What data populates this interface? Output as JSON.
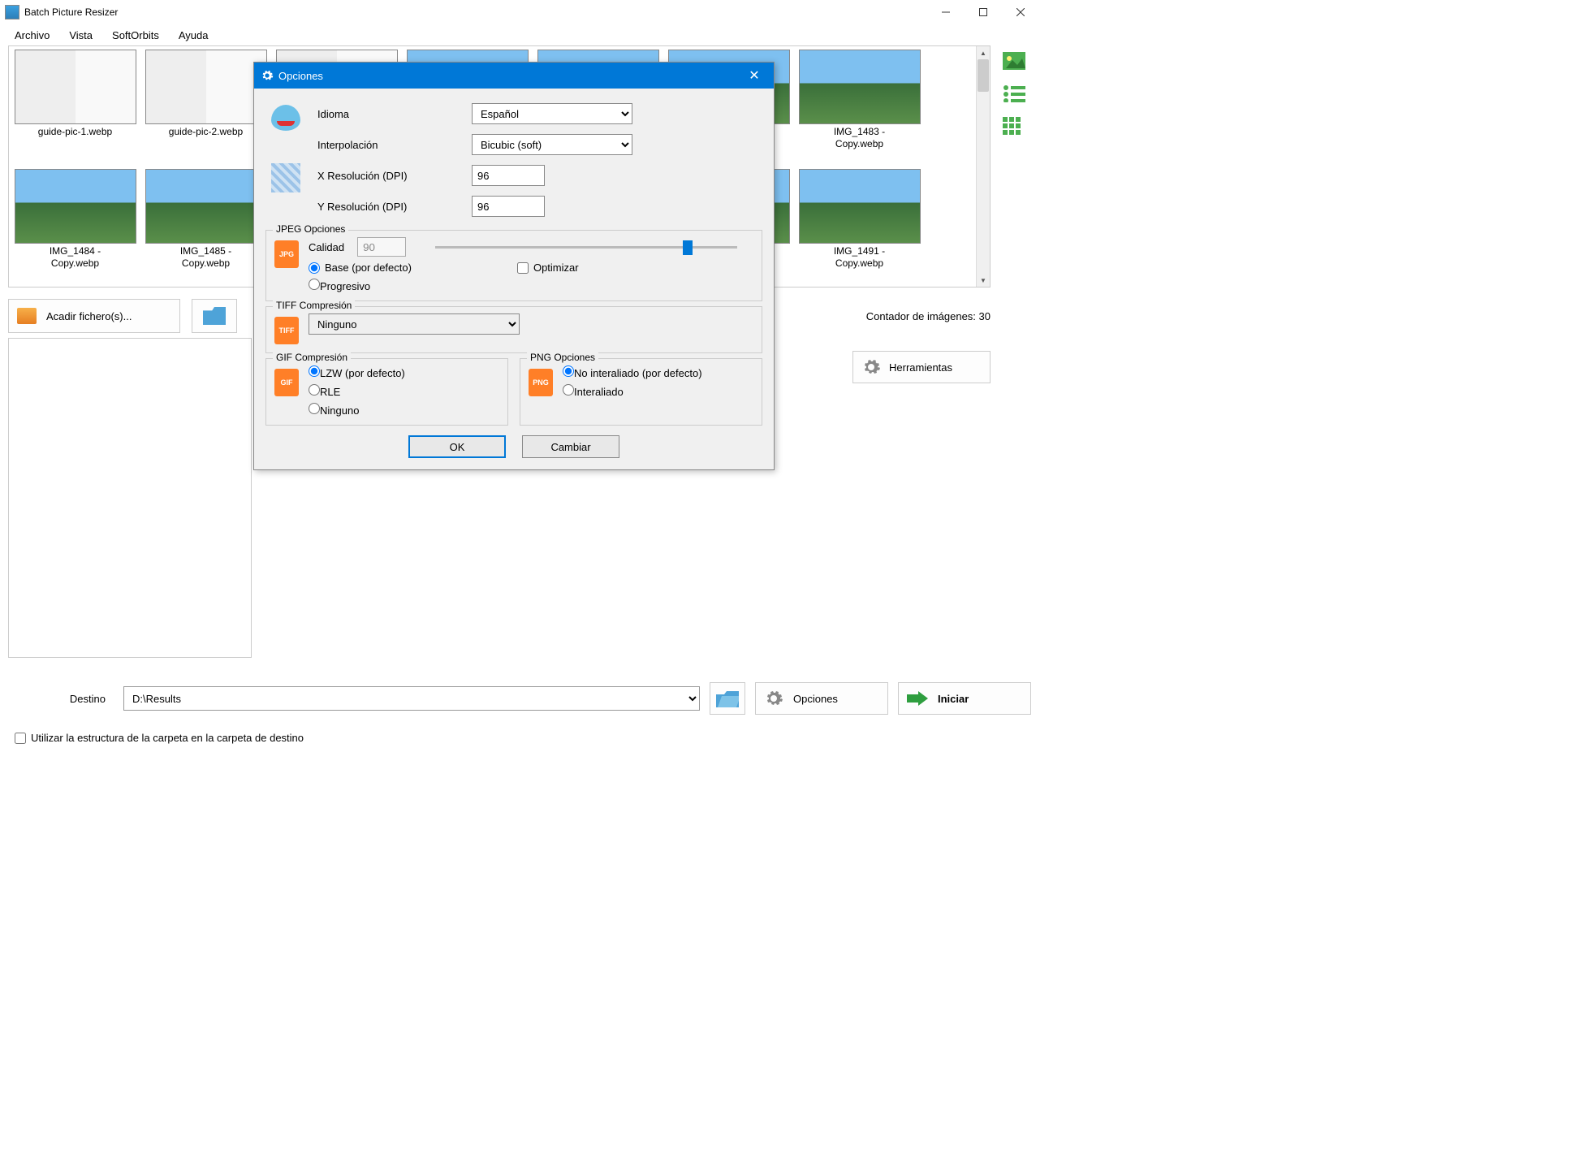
{
  "app": {
    "title": "Batch Picture Resizer"
  },
  "menu": {
    "archivo": "Archivo",
    "vista": "Vista",
    "softorbits": "SoftOrbits",
    "ayuda": "Ayuda"
  },
  "thumbs": [
    {
      "label": "guide-pic-1.webp",
      "kind": "doc"
    },
    {
      "label": "guide-pic-2.webp",
      "kind": "doc"
    },
    {
      "label": "",
      "kind": "doc"
    },
    {
      "label": "",
      "kind": "photo"
    },
    {
      "label": "",
      "kind": "photo"
    },
    {
      "label": "",
      "kind": "photo"
    },
    {
      "label": "IMG_1483 -\nCopy.webp",
      "kind": "photo"
    },
    {
      "label": "IMG_1484 -\nCopy.webp",
      "kind": "photo"
    },
    {
      "label": "IMG_1485 -\nCopy.webp",
      "kind": "photo"
    },
    {
      "label": "",
      "kind": "photo"
    },
    {
      "label": "",
      "kind": "photo"
    },
    {
      "label": "",
      "kind": "photo"
    },
    {
      "label": "",
      "kind": "photo"
    },
    {
      "label": "IMG_1491 -\nCopy.webp",
      "kind": "photo"
    }
  ],
  "toolbar": {
    "add_files": "Acadir fichero(s)...",
    "counter": "Contador de imágenes: 30",
    "herramientas": "Herramientas"
  },
  "bottom": {
    "destino_label": "Destino",
    "destino_value": "D:\\Results",
    "opciones": "Opciones",
    "iniciar": "Iniciar",
    "checkbox": "Utilizar la estructura de la carpeta en la carpeta de destino"
  },
  "dialog": {
    "title": "Opciones",
    "idioma_label": "Idioma",
    "idioma_value": "Español",
    "interp_label": "Interpolación",
    "interp_value": "Bicubic (soft)",
    "xres_label": "X Resolución (DPI)",
    "xres_value": "96",
    "yres_label": "Y Resolución (DPI)",
    "yres_value": "96",
    "jpeg": {
      "group": "JPEG Opciones",
      "calidad_label": "Calidad",
      "calidad_value": "90",
      "base": "Base (por defecto)",
      "optimizar": "Optimizar",
      "progresivo": "Progresivo"
    },
    "tiff": {
      "group": "TIFF Compresión",
      "value": "Ninguno"
    },
    "gif": {
      "group": "GIF Compresión",
      "lzw": "LZW (por defecto)",
      "rle": "RLE",
      "ninguno": "Ninguno"
    },
    "png": {
      "group": "PNG Opciones",
      "noint": "No interaliado (por defecto)",
      "int": "Interaliado"
    },
    "ok": "OK",
    "cambiar": "Cambiar",
    "badges": {
      "jpg": "JPG",
      "tiff": "TIFF",
      "gif": "GIF",
      "png": "PNG"
    }
  }
}
